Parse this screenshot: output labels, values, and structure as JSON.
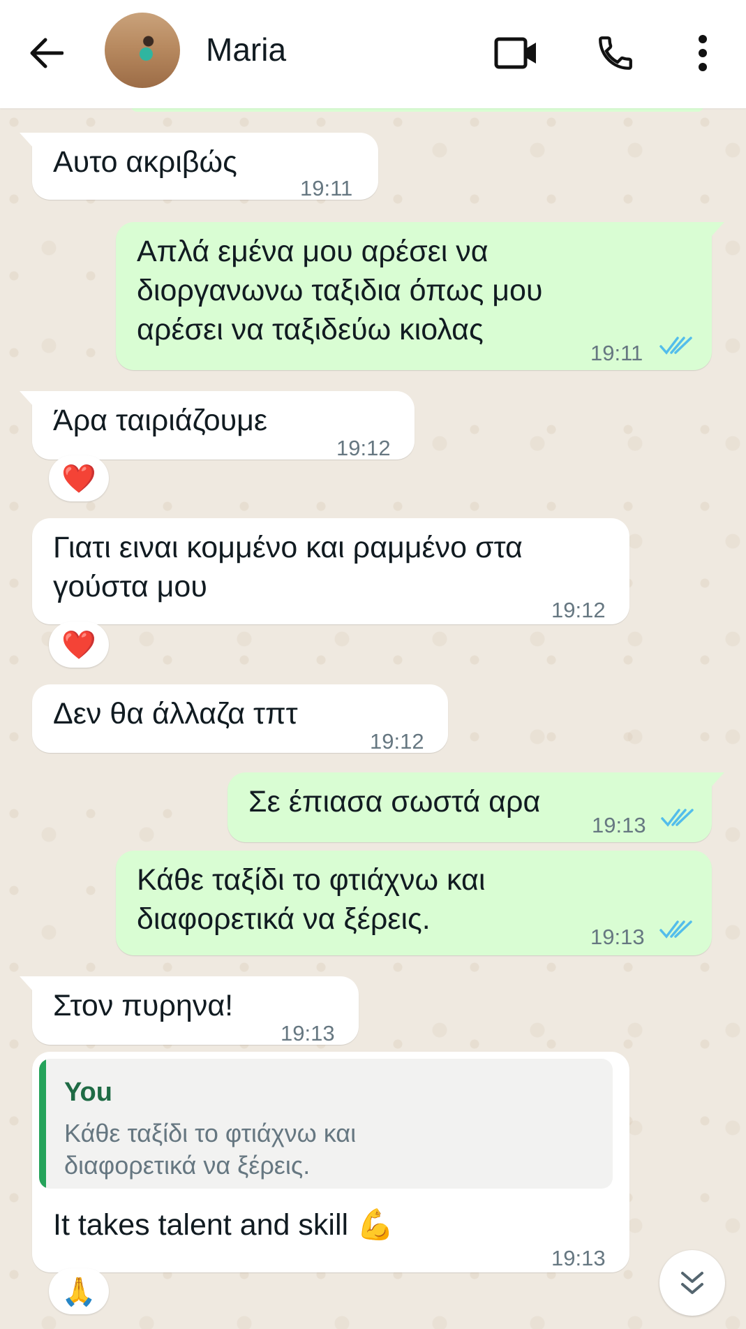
{
  "header": {
    "contact_name": "Maria",
    "icons": [
      "back-arrow-icon",
      "video-call-icon",
      "phone-icon",
      "more-options-icon"
    ]
  },
  "messages": [
    {
      "dir": "in",
      "text": "Αυτο ακριβώς",
      "time": "19:11"
    },
    {
      "dir": "out",
      "text": "Απλά εμένα μου αρέσει να\nδιοργανωνω ταξιδια όπως μου\nαρέσει να ταξιδεύω κιολας",
      "time": "19:11",
      "status": "read"
    },
    {
      "dir": "in",
      "text": "Άρα ταιριάζουμε",
      "time": "19:12",
      "reaction": "❤️"
    },
    {
      "dir": "in",
      "text": "Γιατι ειναι κομμένο και ραμμένο στα\nγούστα μου",
      "time": "19:12",
      "reaction": "❤️"
    },
    {
      "dir": "in",
      "text": "Δεν θα άλλαζα τπτ",
      "time": "19:12"
    },
    {
      "dir": "out",
      "text": "Σε έπιασα σωστά αρα",
      "time": "19:13",
      "status": "read"
    },
    {
      "dir": "out",
      "text": "Κάθε ταξίδι το φτιάχνω και\nδιαφορετικά να ξέρεις.",
      "time": "19:13",
      "status": "read"
    },
    {
      "dir": "in",
      "text": "Στον πυρηνα!",
      "time": "19:13"
    },
    {
      "dir": "in",
      "quote": {
        "author": "You",
        "text": "Κάθε ταξίδι το φτιάχνω και\nδιαφορετικά να ξέρεις."
      },
      "text": "It takes talent and skill 💪",
      "time": "19:13",
      "reaction": "🙏"
    }
  ],
  "colors": {
    "incoming_bubble": "#ffffff",
    "outgoing_bubble": "#d9fdd3",
    "read_ticks": "#53bdeb",
    "quote_bar": "#25a35a",
    "wallpaper": "#efe9e0"
  },
  "scroll_button_icon": "double-chevron-down-icon"
}
